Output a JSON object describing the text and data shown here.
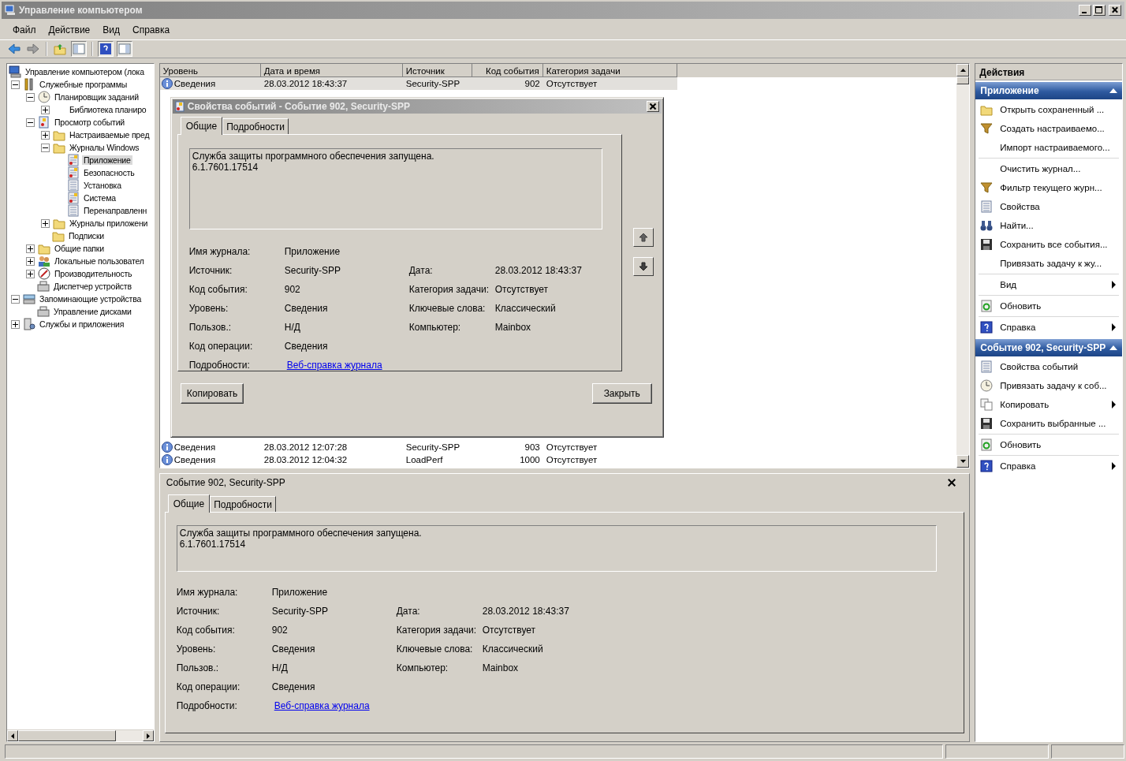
{
  "window": {
    "title": "Управление компьютером"
  },
  "menu": [
    "Файл",
    "Действие",
    "Вид",
    "Справка"
  ],
  "tree": {
    "label": "Управление компьютером (лока",
    "kind": "computer",
    "selected": false,
    "children": [
      {
        "label": "Служебные программы",
        "kind": "tools",
        "expanded": true,
        "selected": false,
        "children": [
          {
            "label": "Планировщик заданий",
            "kind": "clock",
            "expanded": true,
            "selected": false,
            "children": [
              {
                "label": "Библиотека планиро",
                "kind": "none",
                "expanded": false,
                "selected": false
              }
            ]
          },
          {
            "label": "Просмотр событий",
            "kind": "viewer",
            "expanded": true,
            "selected": false,
            "children": [
              {
                "label": "Настраиваемые пред",
                "kind": "folder",
                "expanded": false,
                "selected": false
              },
              {
                "label": "Журналы Windows",
                "kind": "folder",
                "expanded": true,
                "selected": false,
                "children": [
                  {
                    "label": "Приложение",
                    "kind": "log",
                    "selected": true
                  },
                  {
                    "label": "Безопасность",
                    "kind": "log",
                    "selected": false
                  },
                  {
                    "label": "Установка",
                    "kind": "page",
                    "selected": false
                  },
                  {
                    "label": "Система",
                    "kind": "log",
                    "selected": false
                  },
                  {
                    "label": "Перенаправленн",
                    "kind": "page",
                    "selected": false
                  }
                ]
              },
              {
                "label": "Журналы приложени",
                "kind": "folder",
                "expanded": false,
                "selected": false
              },
              {
                "label": "Подписки",
                "kind": "folder",
                "selected": false
              }
            ]
          },
          {
            "label": "Общие папки",
            "kind": "folder",
            "expanded": false,
            "selected": false
          },
          {
            "label": "Локальные пользовател",
            "kind": "users",
            "expanded": false,
            "selected": false
          },
          {
            "label": "Производительность",
            "kind": "gauge",
            "expanded": false,
            "selected": false
          },
          {
            "label": "Диспетчер устройств",
            "kind": "device",
            "selected": false
          }
        ]
      },
      {
        "label": "Запоминающие устройства",
        "kind": "storage",
        "expanded": true,
        "selected": false,
        "children": [
          {
            "label": "Управление дисками",
            "kind": "device",
            "selected": false
          }
        ]
      },
      {
        "label": "Службы и приложения",
        "kind": "services",
        "expanded": false,
        "selected": false
      }
    ]
  },
  "events": {
    "columns": [
      "Уровень",
      "Дата и время",
      "Источник",
      "Код события",
      "Категория задачи"
    ],
    "rows": [
      {
        "kind": "info",
        "level": "Сведения",
        "datetime": "28.03.2012 18:43:37",
        "source": "Security-SPP",
        "event_id": "902",
        "category": "Отсутствует",
        "selected": true
      },
      {
        "kind": "info",
        "level": "Сведения",
        "datetime": "28.03.2012 12:07:28",
        "source": "Security-SPP",
        "event_id": "903",
        "category": "Отсутствует",
        "selected": false
      },
      {
        "kind": "info",
        "level": "Сведения",
        "datetime": "28.03.2012 12:04:32",
        "source": "LoadPerf",
        "event_id": "1000",
        "category": "Отсутствует",
        "selected": false
      }
    ]
  },
  "dialog": {
    "title": "Свойства событий - Событие 902, Security-SPP",
    "tabs": [
      {
        "label": "Общие",
        "selected": true
      },
      {
        "label": "Подробности",
        "selected": false
      }
    ],
    "details": {
      "message": [
        "Служба защиты программного обеспечения запущена.",
        "6.1.7601.17514"
      ],
      "left": [
        {
          "label": "Имя журнала:",
          "value": "Приложение",
          "kind": "text"
        },
        {
          "label": "Источник:",
          "value": "Security-SPP",
          "kind": "text"
        },
        {
          "label": "Код события:",
          "value": "902",
          "kind": "text"
        },
        {
          "label": "Уровень:",
          "value": "Сведения",
          "kind": "text"
        },
        {
          "label": "Пользов.:",
          "value": "Н/Д",
          "kind": "text"
        },
        {
          "label": "Код операции:",
          "value": "Сведения",
          "kind": "text"
        },
        {
          "label": "Подробности:",
          "value": "Веб-справка журнала",
          "kind": "link"
        }
      ],
      "right": [
        {
          "label": "Дата:",
          "value": "28.03.2012 18:43:37"
        },
        {
          "label": "Категория задачи:",
          "value": "Отсутствует"
        },
        {
          "label": "Ключевые слова:",
          "value": "Классический"
        },
        {
          "label": "Компьютер:",
          "value": "Mainbox"
        }
      ]
    },
    "buttons": [
      "Копировать",
      "Закрыть"
    ]
  },
  "preview": {
    "title": "Событие 902, Security-SPP",
    "tabs": [
      {
        "label": "Общие",
        "selected": true
      },
      {
        "label": "Подробности",
        "selected": false
      }
    ],
    "details": {
      "message": [
        "Служба защиты программного обеспечения запущена.",
        "6.1.7601.17514"
      ],
      "left": [
        {
          "label": "Имя журнала:",
          "value": "Приложение",
          "kind": "text"
        },
        {
          "label": "Источник:",
          "value": "Security-SPP",
          "kind": "text"
        },
        {
          "label": "Код события:",
          "value": "902",
          "kind": "text"
        },
        {
          "label": "Уровень:",
          "value": "Сведения",
          "kind": "text"
        },
        {
          "label": "Пользов.:",
          "value": "Н/Д",
          "kind": "text"
        },
        {
          "label": "Код операции:",
          "value": "Сведения",
          "kind": "text"
        },
        {
          "label": "Подробности:",
          "value": "Веб-справка журнала",
          "kind": "link"
        }
      ],
      "right": [
        {
          "label": "Дата:",
          "value": "28.03.2012 18:43:37"
        },
        {
          "label": "Категория задачи:",
          "value": "Отсутствует"
        },
        {
          "label": "Ключевые слова:",
          "value": "Классический"
        },
        {
          "label": "Компьютер:",
          "value": "Mainbox"
        }
      ]
    }
  },
  "actions": {
    "title": "Действия",
    "sections": [
      {
        "title": "Приложение",
        "expanded": true,
        "groups": [
          [
            {
              "label": "Открыть сохраненный ...",
              "kind": "folder",
              "submenu": false
            },
            {
              "label": "Создать настраиваемо...",
              "kind": "filter",
              "submenu": false
            },
            {
              "label": "Импорт настраиваемого...",
              "kind": "none",
              "submenu": false
            }
          ],
          [
            {
              "label": "Очистить журнал...",
              "kind": "none",
              "submenu": false
            },
            {
              "label": "Фильтр текущего журн...",
              "kind": "filter",
              "submenu": false
            },
            {
              "label": "Свойства",
              "kind": "page",
              "submenu": false
            },
            {
              "label": "Найти...",
              "kind": "binoculars",
              "submenu": false
            },
            {
              "label": "Сохранить все события...",
              "kind": "disk",
              "submenu": false
            },
            {
              "label": "Привязать задачу к жу...",
              "kind": "none",
              "submenu": false
            }
          ],
          [
            {
              "label": "Вид",
              "kind": "none",
              "submenu": true
            }
          ],
          [
            {
              "label": "Обновить",
              "kind": "refresh",
              "submenu": false
            }
          ],
          [
            {
              "label": "Справка",
              "kind": "help",
              "submenu": true
            }
          ]
        ]
      },
      {
        "title": "Событие 902, Security-SPP",
        "expanded": true,
        "groups": [
          [
            {
              "label": "Свойства событий",
              "kind": "page",
              "submenu": false
            },
            {
              "label": "Привязать задачу к соб...",
              "kind": "clock",
              "submenu": false
            },
            {
              "label": "Копировать",
              "kind": "copy",
              "submenu": true
            },
            {
              "label": "Сохранить выбранные ...",
              "kind": "disk",
              "submenu": false
            }
          ],
          [
            {
              "label": "Обновить",
              "kind": "refresh",
              "submenu": false
            }
          ],
          [
            {
              "label": "Справка",
              "kind": "help",
              "submenu": true
            }
          ]
        ]
      }
    ]
  }
}
